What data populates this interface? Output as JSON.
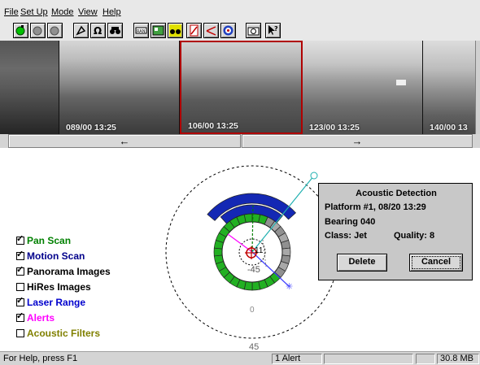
{
  "menu": [
    "File",
    "Set Up",
    "Mode",
    "View",
    "Help"
  ],
  "toolbar": {
    "buttons": [
      "record-green-icon",
      "record-gray-icon",
      "record-gray-icon",
      "pan-tilt-icon",
      "omega-icon",
      "binoculars-icon",
      "range-icon",
      "panorama-icon",
      "binoculars-yellow-icon",
      "filter-red-icon",
      "laser-icon",
      "target-icon",
      "camera-icon",
      "help-pointer-icon"
    ]
  },
  "filmstrip": {
    "frames": [
      {
        "timestamp": ""
      },
      {
        "timestamp": "089/00 13:25"
      },
      {
        "timestamp": "106/00 13:25"
      },
      {
        "timestamp": "123/00 13:25"
      },
      {
        "timestamp": "140/00 13"
      }
    ],
    "nav": {
      "prev": "←",
      "next": "→"
    }
  },
  "legend": [
    {
      "label": "Pan Scan",
      "checked": true,
      "color": "#008000"
    },
    {
      "label": "Motion Scan",
      "checked": true,
      "color": "#00008b"
    },
    {
      "label": "Panorama Images",
      "checked": true,
      "color": "#000000"
    },
    {
      "label": "HiRes Images",
      "checked": false,
      "color": "#000000"
    },
    {
      "label": "Laser Range",
      "checked": true,
      "color": "#0000cd"
    },
    {
      "label": "Alerts",
      "checked": true,
      "color": "#ff00ff"
    },
    {
      "label": "Acoustic Filters",
      "checked": false,
      "color": "#808000"
    }
  ],
  "radar": {
    "label_top": "11",
    "label_minus": "-45",
    "label_zero": "0",
    "label_bottom": "45"
  },
  "dialog": {
    "title": "Acoustic Detection",
    "line1": "Platform #1, 08/20 13:29",
    "line2": "Bearing 040",
    "class_label": "Class: Jet",
    "quality_label": "Quality: 8",
    "delete": "Delete",
    "cancel": "Cancel"
  },
  "status": {
    "help": "For Help, press F1",
    "alerts": "1 Alert",
    "memory": "30.8 MB"
  }
}
